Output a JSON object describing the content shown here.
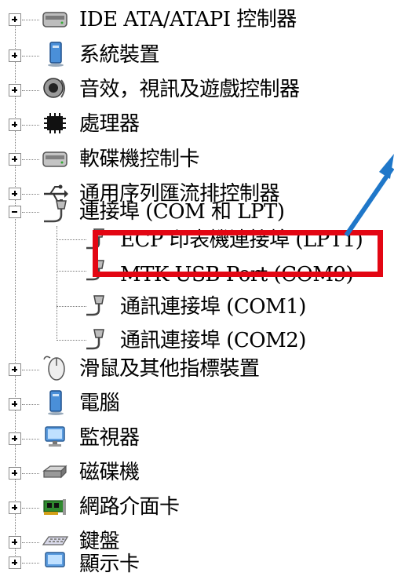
{
  "tree": {
    "items": [
      {
        "label": "IDE ATA/ATAPI 控制器",
        "icon": "ide-controller-icon",
        "state": "collapsed"
      },
      {
        "label": "系統裝置",
        "icon": "system-device-icon",
        "state": "collapsed"
      },
      {
        "label": "音效，視訊及遊戲控制器",
        "icon": "sound-icon",
        "state": "collapsed"
      },
      {
        "label": "處理器",
        "icon": "processor-chip-icon",
        "state": "collapsed"
      },
      {
        "label": "軟碟機控制卡",
        "icon": "floppy-controller-icon",
        "state": "collapsed"
      },
      {
        "label": "通用序列匯流排控制器",
        "icon": "usb-icon",
        "state": "collapsed"
      },
      {
        "label": "連接埠 (COM 和 LPT)",
        "icon": "port-connector-icon",
        "state": "expanded",
        "children": [
          {
            "label": "ECP 印表機連接埠 (LPT1)",
            "icon": "port-connector-icon"
          },
          {
            "label": "MTK USB Port (COM9)",
            "icon": "port-connector-icon",
            "highlighted": true
          },
          {
            "label": "通訊連接埠 (COM1)",
            "icon": "port-connector-icon"
          },
          {
            "label": "通訊連接埠 (COM2)",
            "icon": "port-connector-icon"
          }
        ]
      },
      {
        "label": "滑鼠及其他指標裝置",
        "icon": "mouse-icon",
        "state": "collapsed"
      },
      {
        "label": "電腦",
        "icon": "computer-icon",
        "state": "collapsed"
      },
      {
        "label": "監視器",
        "icon": "monitor-icon",
        "state": "collapsed"
      },
      {
        "label": "磁碟機",
        "icon": "disk-drive-icon",
        "state": "collapsed"
      },
      {
        "label": "網路介面卡",
        "icon": "network-adapter-icon",
        "state": "collapsed"
      },
      {
        "label": "鍵盤",
        "icon": "keyboard-icon",
        "state": "collapsed"
      },
      {
        "label": "顯示卡",
        "icon": "display-adapter-icon",
        "state": "collapsed"
      }
    ]
  },
  "annotation": {
    "highlight_color": "#e30613",
    "arrow_color": "#1f77c9"
  }
}
